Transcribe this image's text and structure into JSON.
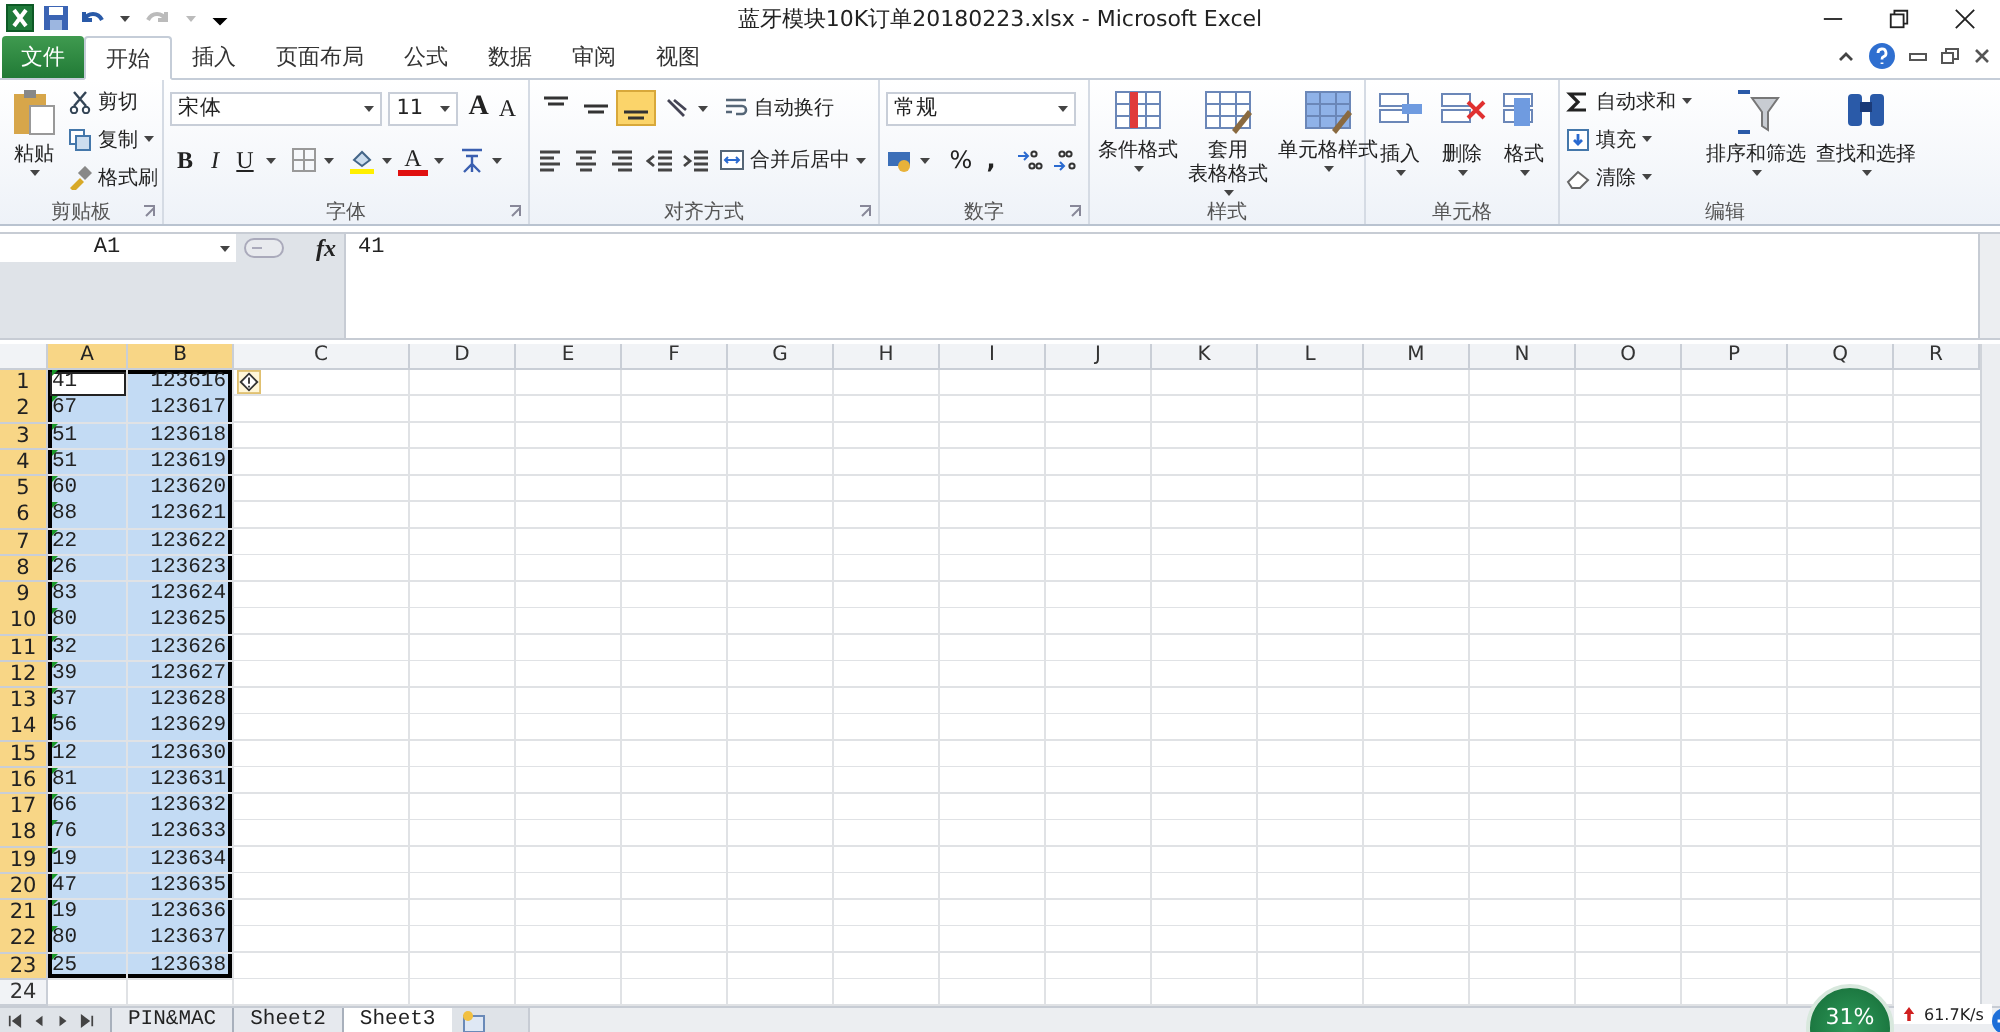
{
  "title_bar": {
    "title": "蓝牙模块10K订单20180223.xlsx  -  Microsoft Excel"
  },
  "tabs": [
    {
      "label": "文件",
      "kind": "file",
      "selected": false
    },
    {
      "label": "开始",
      "kind": "tab",
      "selected": true
    },
    {
      "label": "插入",
      "kind": "tab",
      "selected": false
    },
    {
      "label": "页面布局",
      "kind": "tab",
      "selected": false
    },
    {
      "label": "公式",
      "kind": "tab",
      "selected": false
    },
    {
      "label": "数据",
      "kind": "tab",
      "selected": false
    },
    {
      "label": "审阅",
      "kind": "tab",
      "selected": false
    },
    {
      "label": "视图",
      "kind": "tab",
      "selected": false
    }
  ],
  "clipboard": {
    "label": "剪贴板",
    "paste": "粘贴",
    "commands": [
      "剪切",
      "复制",
      "格式刷"
    ]
  },
  "font": {
    "label": "字体",
    "font_name": "宋体",
    "font_size": "11",
    "grow": "A",
    "shrink": "A",
    "bold": "B",
    "italic": "I",
    "underline": "U",
    "font_color": "A"
  },
  "alignment": {
    "label": "对齐方式",
    "vertical": [
      {
        "selected": false
      },
      {
        "selected": false
      },
      {
        "selected": true
      }
    ],
    "wrap": "自动换行",
    "merge": "合并后居中"
  },
  "number": {
    "label": "数字",
    "format": "常规",
    "percent": "%",
    "comma": ","
  },
  "styles": {
    "label": "样式",
    "buttons": [
      {
        "lines": [
          "条件格式"
        ]
      },
      {
        "lines": [
          "套用",
          "表格格式"
        ]
      },
      {
        "lines": [
          "单元格样式"
        ]
      }
    ]
  },
  "cells": {
    "label": "单元格",
    "buttons": [
      "插入",
      "删除",
      "格式"
    ]
  },
  "editing": {
    "label": "编辑",
    "commands": [
      "自动求和",
      "填充",
      "清除"
    ],
    "buttons": [
      "排序和筛选",
      "查找和选择"
    ]
  },
  "formula_bar": {
    "name_box": "A1",
    "function_label": "fx",
    "formula": "41"
  },
  "sheet": {
    "columns": [
      {
        "label": "A",
        "selected": true
      },
      {
        "label": "B",
        "selected": true
      },
      {
        "label": "C",
        "selected": false
      },
      {
        "label": "D",
        "selected": false
      },
      {
        "label": "E",
        "selected": false
      },
      {
        "label": "F",
        "selected": false
      },
      {
        "label": "G",
        "selected": false
      },
      {
        "label": "H",
        "selected": false
      },
      {
        "label": "I",
        "selected": false
      },
      {
        "label": "J",
        "selected": false
      },
      {
        "label": "K",
        "selected": false
      },
      {
        "label": "L",
        "selected": false
      },
      {
        "label": "M",
        "selected": false
      },
      {
        "label": "N",
        "selected": false
      },
      {
        "label": "O",
        "selected": false
      },
      {
        "label": "P",
        "selected": false
      },
      {
        "label": "Q",
        "selected": false
      },
      {
        "label": "R",
        "selected": false
      }
    ],
    "rows": [
      {
        "number": "1",
        "cells": [
          "41",
          "123616"
        ],
        "selected": true,
        "active": true
      },
      {
        "number": "2",
        "cells": [
          "67",
          "123617"
        ],
        "selected": true,
        "active": false
      },
      {
        "number": "3",
        "cells": [
          "51",
          "123618"
        ],
        "selected": true,
        "active": false
      },
      {
        "number": "4",
        "cells": [
          "51",
          "123619"
        ],
        "selected": true,
        "active": false
      },
      {
        "number": "5",
        "cells": [
          "60",
          "123620"
        ],
        "selected": true,
        "active": false
      },
      {
        "number": "6",
        "cells": [
          "88",
          "123621"
        ],
        "selected": true,
        "active": false
      },
      {
        "number": "7",
        "cells": [
          "22",
          "123622"
        ],
        "selected": true,
        "active": false
      },
      {
        "number": "8",
        "cells": [
          "26",
          "123623"
        ],
        "selected": true,
        "active": false
      },
      {
        "number": "9",
        "cells": [
          "83",
          "123624"
        ],
        "selected": true,
        "active": false
      },
      {
        "number": "10",
        "cells": [
          "80",
          "123625"
        ],
        "selected": true,
        "active": false
      },
      {
        "number": "11",
        "cells": [
          "32",
          "123626"
        ],
        "selected": true,
        "active": false
      },
      {
        "number": "12",
        "cells": [
          "39",
          "123627"
        ],
        "selected": true,
        "active": false
      },
      {
        "number": "13",
        "cells": [
          "37",
          "123628"
        ],
        "selected": true,
        "active": false
      },
      {
        "number": "14",
        "cells": [
          "56",
          "123629"
        ],
        "selected": true,
        "active": false
      },
      {
        "number": "15",
        "cells": [
          "12",
          "123630"
        ],
        "selected": true,
        "active": false
      },
      {
        "number": "16",
        "cells": [
          "81",
          "123631"
        ],
        "selected": true,
        "active": false
      },
      {
        "number": "17",
        "cells": [
          "66",
          "123632"
        ],
        "selected": true,
        "active": false
      },
      {
        "number": "18",
        "cells": [
          "76",
          "123633"
        ],
        "selected": true,
        "active": false
      },
      {
        "number": "19",
        "cells": [
          "19",
          "123634"
        ],
        "selected": true,
        "active": false
      },
      {
        "number": "20",
        "cells": [
          "47",
          "123635"
        ],
        "selected": true,
        "active": false
      },
      {
        "number": "21",
        "cells": [
          "19",
          "123636"
        ],
        "selected": true,
        "active": false
      },
      {
        "number": "22",
        "cells": [
          "80",
          "123637"
        ],
        "selected": true,
        "active": false
      },
      {
        "number": "23",
        "cells": [
          "25",
          "123638"
        ],
        "selected": true,
        "active": false
      },
      {
        "number": "24",
        "selected": false
      }
    ]
  },
  "sheet_tabs": [
    {
      "label": "PIN&MAC",
      "selected": false
    },
    {
      "label": "Sheet2",
      "selected": false
    },
    {
      "label": "Sheet3",
      "selected": true
    }
  ],
  "speed_widget": {
    "percent": "31%",
    "speed": "61.7K/s"
  }
}
